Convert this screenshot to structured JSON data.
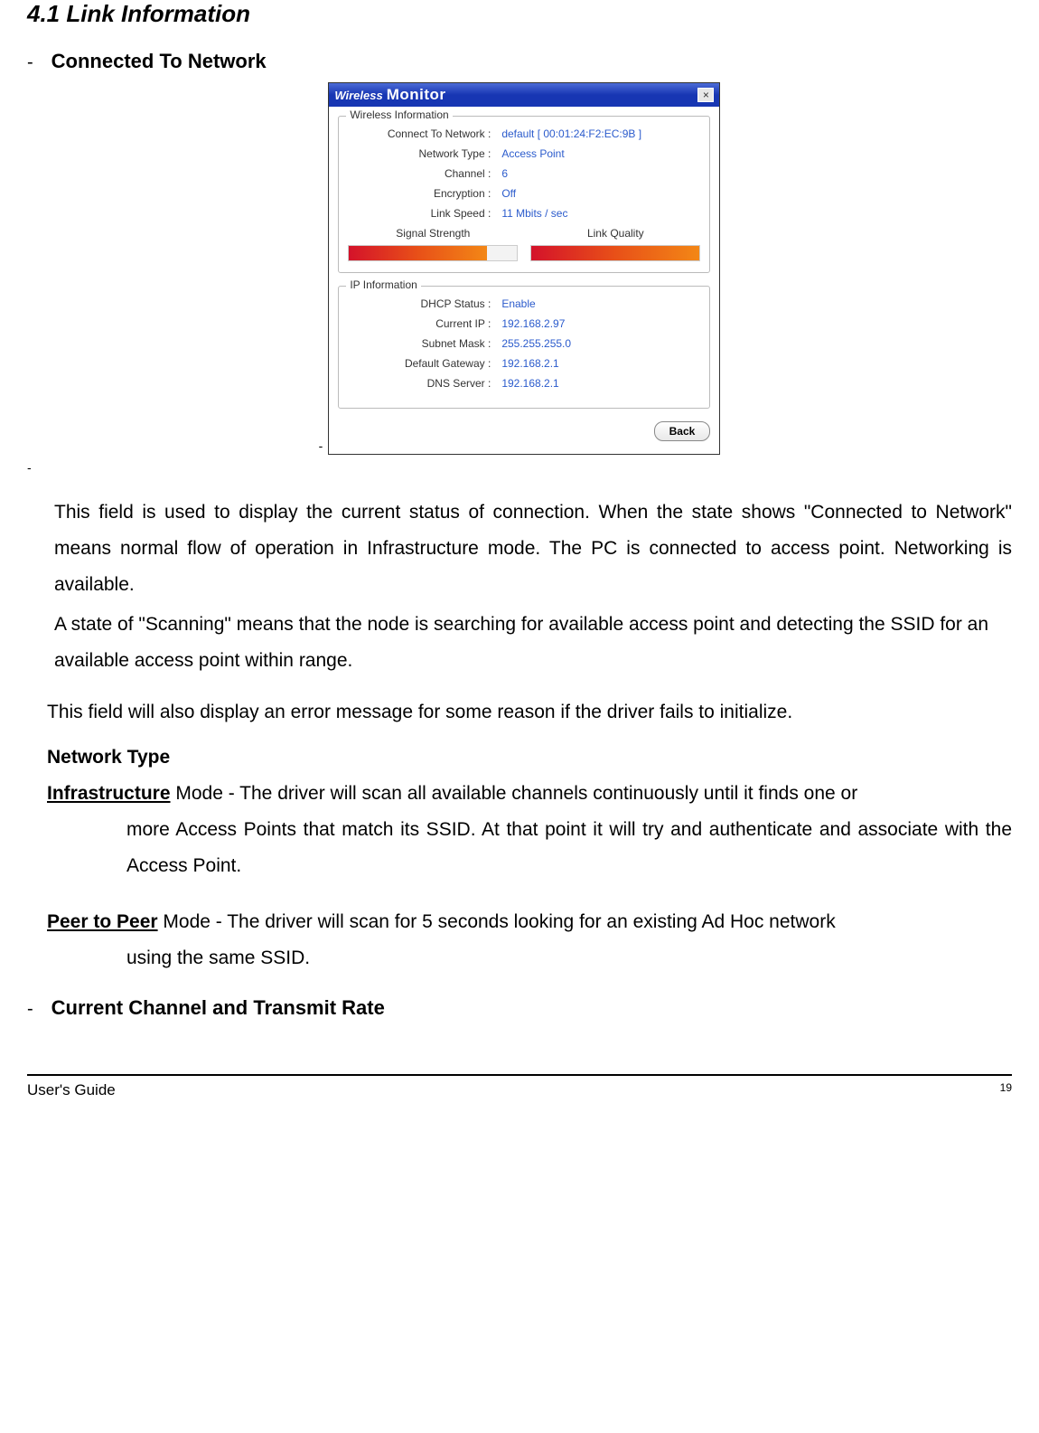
{
  "section_heading": "4.1 Link Information",
  "connected_heading": "Connected To Network",
  "wireless_monitor": {
    "title_wireless": "Wireless",
    "title_monitor": "Monitor",
    "close_symbol": "×",
    "wireless_info_legend": "Wireless Information",
    "wireless_info": {
      "connect_label": "Connect To Network :",
      "connect_value": "default [ 00:01:24:F2:EC:9B ]",
      "type_label": "Network Type :",
      "type_value": "Access Point",
      "channel_label": "Channel :",
      "channel_value": "6",
      "encryption_label": "Encryption :",
      "encryption_value": "Off",
      "speed_label": "Link Speed :",
      "speed_value": "11 Mbits / sec"
    },
    "signal_strength_label": "Signal Strength",
    "link_quality_label": "Link Quality",
    "ip_info_legend": "IP Information",
    "ip_info": {
      "dhcp_label": "DHCP Status :",
      "dhcp_value": "Enable",
      "ip_label": "Current IP :",
      "ip_value": "192.168.2.97",
      "mask_label": "Subnet Mask :",
      "mask_value": "255.255.255.0",
      "gateway_label": "Default Gateway :",
      "gateway_value": "192.168.2.1",
      "dns_label": "DNS Server :",
      "dns_value": "192.168.2.1"
    },
    "back_button": "Back"
  },
  "para1": "This field is used to display the current status of connection. When the state shows \"Connected to Network\" means normal flow of operation in Infrastructure mode. The PC is connected to access point.  Networking is available.",
  "para2": "A state of \"Scanning\" means that the node is searching for available access point and detecting the SSID for an available access point within range.",
  "para3": "This field will also display an error message for some reason if the driver fails to initialize.",
  "network_type_heading": "Network Type",
  "infra_mode_name": "Infrastructure",
  "infra_mode_text_first": " Mode   - The driver will scan all available channels continuously until it finds one or",
  "infra_mode_text_cont": "more Access Points that match its SSID.  At that point it will try and authenticate and associate with the Access Point.",
  "peer_mode_name": "Peer to Peer",
  "peer_mode_text_first": " Mode   - The driver will scan for 5 seconds looking for an existing Ad Hoc network",
  "peer_mode_text_cont": "using the same SSID.",
  "current_channel_heading": "Current Channel and Transmit Rate",
  "footer_left": "User's Guide",
  "footer_page": "19",
  "dash": "-"
}
